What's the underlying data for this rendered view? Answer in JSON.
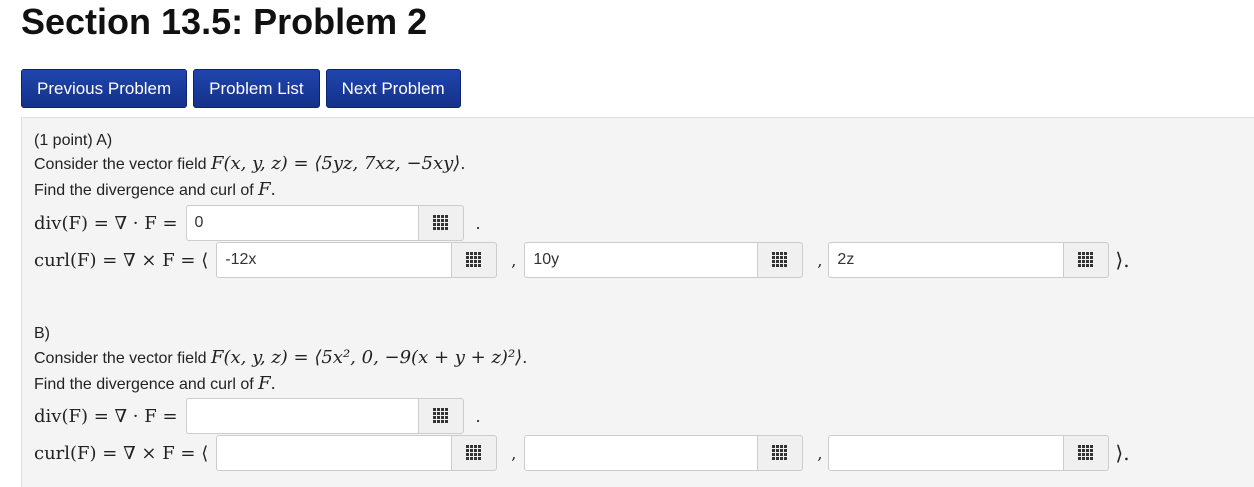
{
  "title": "Section 13.5: Problem 2",
  "nav": {
    "previous": "Previous Problem",
    "list": "Problem List",
    "next": "Next Problem"
  },
  "partA": {
    "header": "(1 point) A)",
    "intro": "Consider the vector field",
    "field_expr": "F(x, y, z) = ⟨5yz, 7xz, −5xy⟩",
    "find": "Find the divergence and curl of",
    "div_label": "div(F) = ∇ · F =",
    "curl_label": "curl(F) = ∇ × F = ⟨",
    "div_value": "0",
    "curl_values": [
      "-12x",
      "10y",
      "2z"
    ]
  },
  "partB": {
    "header": "B)",
    "intro": "Consider the vector field",
    "field_expr": "F(x, y, z) = ⟨5x², 0, −9(x + y + z)²⟩",
    "find": "Find the divergence and curl of",
    "div_label": "div(F) = ∇ · F =",
    "curl_label": "curl(F) = ∇ × F = ⟨",
    "div_value": "",
    "curl_values": [
      "",
      "",
      ""
    ]
  },
  "symbols": {
    "F": "F",
    "period": ".",
    "comma": ",",
    "close": "⟩."
  },
  "icons": {
    "palette": "equation-palette-icon"
  },
  "colors": {
    "button_bg": "#1b3a96",
    "panel_bg": "#f4f4f4"
  }
}
